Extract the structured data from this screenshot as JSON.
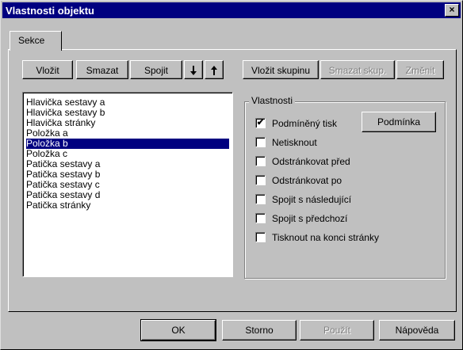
{
  "window": {
    "title": "Vlastnosti objektu",
    "close_symbol": "×"
  },
  "tabs": [
    {
      "label": "Sekce"
    }
  ],
  "toolbar": {
    "vlozit": "Vložit",
    "smazat": "Smazat",
    "spojit": "Spojit",
    "down_arrow": "🠗",
    "up_arrow": "🠕",
    "vlozit_skupinu": "Vložit skupinu",
    "smazat_skup": "Smazat skup.",
    "zmenit": "Změnit"
  },
  "sections": {
    "items": [
      "Hlavička sestavy a",
      "Hlavička sestavy b",
      "Hlavička stránky",
      "Položka a",
      "Položka b",
      "Položka c",
      "Patička sestavy a",
      "Patička sestavy b",
      "Patička sestavy c",
      "Patička sestavy d",
      "Patička stránky"
    ],
    "selected": "Položka b"
  },
  "properties": {
    "group_label": "Vlastnosti",
    "podminka_button": "Podmínka",
    "checkboxes": [
      {
        "label": "Podmíněný tisk",
        "checked": true
      },
      {
        "label": "Netisknout",
        "checked": false
      },
      {
        "label": "Odstránkovat před",
        "checked": false
      },
      {
        "label": "Odstránkovat po",
        "checked": false
      },
      {
        "label": "Spojit s následující",
        "checked": false
      },
      {
        "label": "Spojit s předchozí",
        "checked": false
      },
      {
        "label": "Tisknout na konci stránky",
        "checked": false
      }
    ]
  },
  "footer": {
    "ok": "OK",
    "storno": "Storno",
    "pouzit": "Použít",
    "napoveda": "Nápověda"
  }
}
